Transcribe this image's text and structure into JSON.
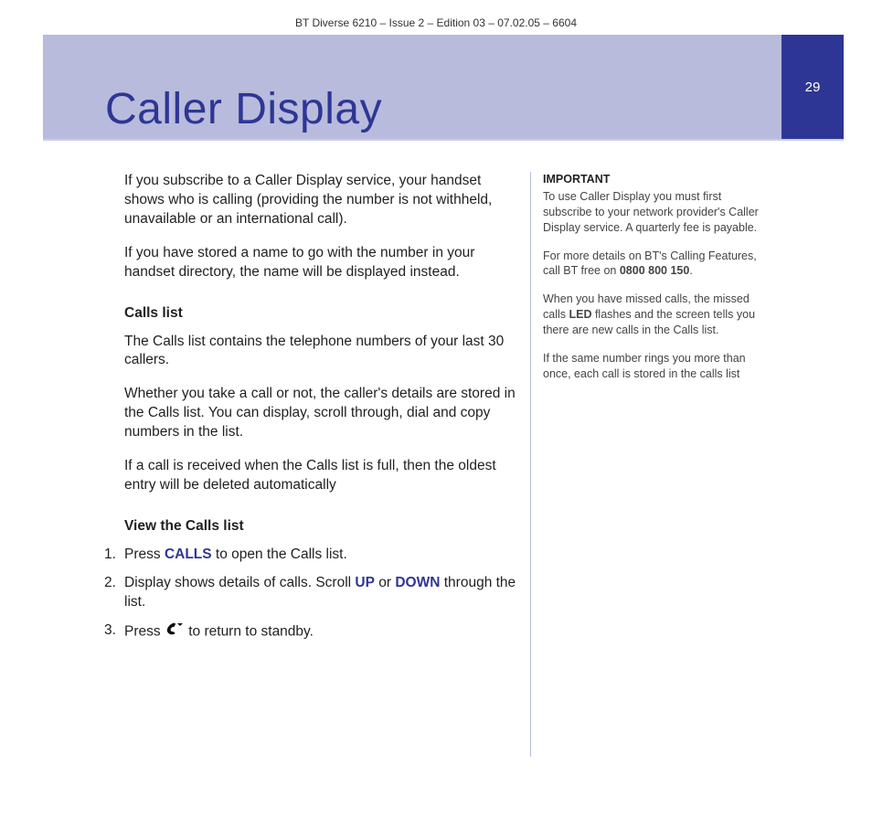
{
  "doc_header": "BT Diverse 6210 – Issue 2 – Edition 03 – 07.02.05 – 6604",
  "page_number": "29",
  "title": "Caller Display",
  "main": {
    "p1": "If you subscribe to a Caller Display service, your handset shows who is calling (providing the number is not withheld, unavailable or an international call).",
    "p2": "If you have stored a name to go with the number in your handset directory, the name will be displayed instead.",
    "h1": "Calls list",
    "p3": "The Calls list contains the telephone numbers of your last 30 callers.",
    "p4": "Whether you take a call or not, the caller's details are stored in the Calls list. You can display, scroll through, dial and copy numbers in the list.",
    "p5": "If a call is received when the Calls list is full, then the oldest entry will be deleted automatically",
    "h2": "View the Calls list",
    "step1_pre": "Press ",
    "step1_kw": "CALLS",
    "step1_post": " to open the Calls list.",
    "step2_pre": "Display shows details of calls. Scroll ",
    "step2_kw1": "UP",
    "step2_mid": " or ",
    "step2_kw2": "DOWN",
    "step2_post": " through the list.",
    "step3_pre": "Press ",
    "step3_post": " to return to standby."
  },
  "side": {
    "imp_head": "IMPORTANT",
    "imp_body": "To use Caller Display you must first subscribe to your network provider's Caller Display service. A quarterly fee is payable.",
    "more_pre": "For more details on BT's Calling Features, call BT free on ",
    "more_num": "0800 800 150",
    "more_post": ".",
    "miss_pre": "When you have missed calls, the missed calls ",
    "miss_kw": "LED",
    "miss_post": " flashes and the screen tells you there are new calls in the Calls list.",
    "same": "If the same number rings you more than once, each call is stored in the calls list"
  }
}
